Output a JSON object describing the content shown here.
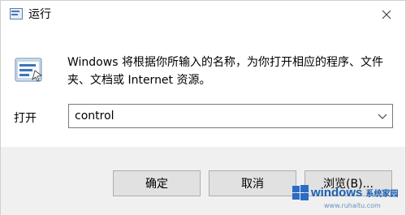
{
  "window": {
    "title": "运行",
    "close_glyph": "✕"
  },
  "content": {
    "description": "Windows 将根据你所输入的名称，为你打开相应的程序、文件夹、文档或 Internet 资源。",
    "open_label": "打开",
    "combo_value": "control"
  },
  "buttons": {
    "ok": "确定",
    "cancel": "取消",
    "browse": "浏览(B)..."
  },
  "watermark": {
    "brand": "windows",
    "suffix": "系统家园",
    "url": "www.ruhaitu.com"
  },
  "icons": {
    "title": "run-icon",
    "main": "run-icon",
    "close": "close-icon",
    "dropdown": "chevron-down-icon"
  },
  "colors": {
    "footer_bg": "#f0f0f0",
    "button_bg": "#e1e1e1",
    "accent": "#1a5fb4"
  }
}
